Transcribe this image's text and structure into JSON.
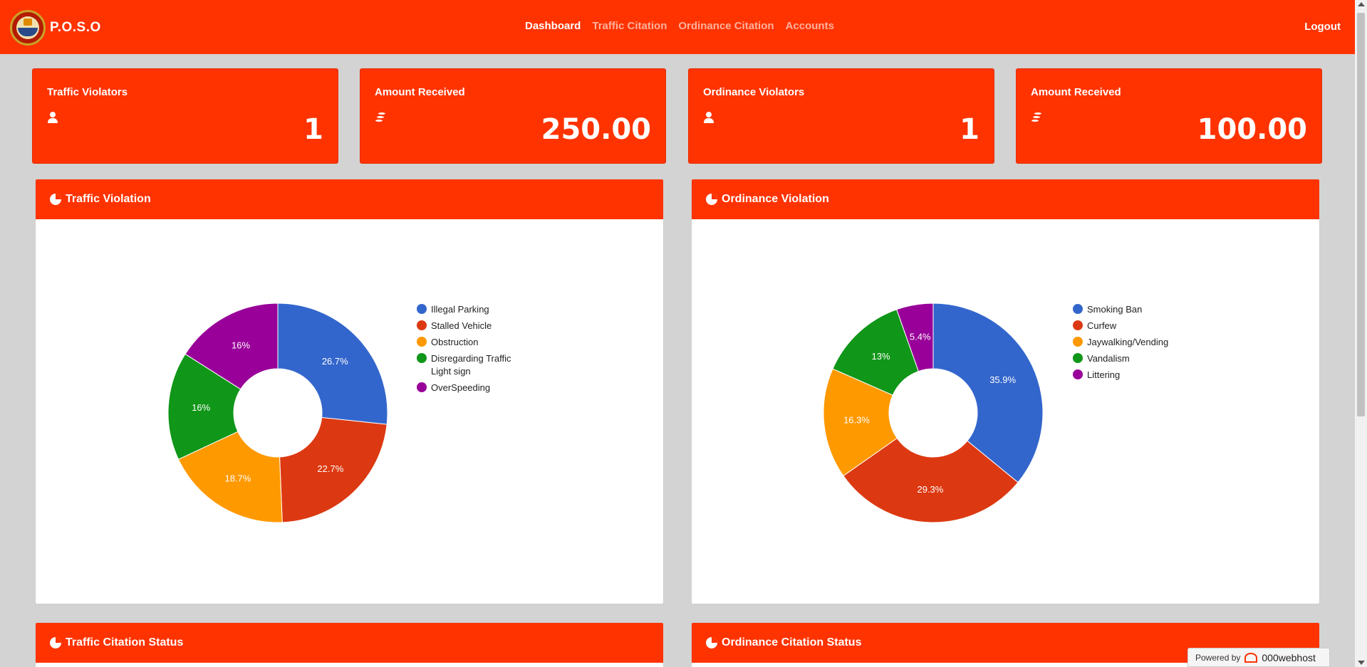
{
  "app": {
    "brand": "P.O.S.O"
  },
  "nav": {
    "items": [
      {
        "label": "Dashboard",
        "active": true
      },
      {
        "label": "Traffic Citation",
        "active": false
      },
      {
        "label": "Ordinance Citation",
        "active": false
      },
      {
        "label": "Accounts",
        "active": false
      }
    ],
    "logout": "Logout"
  },
  "stats": [
    {
      "title": "Traffic Violators",
      "icon": "user-icon",
      "value": "1"
    },
    {
      "title": "Amount Received",
      "icon": "coins-icon",
      "value": "250.00"
    },
    {
      "title": "Ordinance Violators",
      "icon": "user-icon",
      "value": "1"
    },
    {
      "title": "Amount Received",
      "icon": "coins-icon",
      "value": "100.00"
    }
  ],
  "panels": {
    "traffic": {
      "title": "Traffic Violation"
    },
    "ordinance": {
      "title": "Ordinance Violation"
    },
    "traffic_status": {
      "title": "Traffic Citation Status"
    },
    "ordinance_status": {
      "title": "Ordinance Citation Status"
    }
  },
  "colors": {
    "accent": "#ff3300",
    "background": "#d3d3d3",
    "series": [
      "#3366cc",
      "#dc3912",
      "#ff9900",
      "#109618",
      "#990099"
    ]
  },
  "chart_data": [
    {
      "type": "pie",
      "donut": true,
      "title": "Traffic Violation",
      "categories": [
        "Illegal Parking",
        "Stalled Vehicle",
        "Obstruction",
        "Disregarding Traffic Light sign",
        "OverSpeeding"
      ],
      "values": [
        26.7,
        22.7,
        18.7,
        16,
        16
      ],
      "labels": [
        "26.7%",
        "22.7%",
        "18.7%",
        "16%",
        "16%"
      ],
      "legend": "right"
    },
    {
      "type": "pie",
      "donut": true,
      "title": "Ordinance Violation",
      "categories": [
        "Smoking Ban",
        "Curfew",
        "Jaywalking/Vending",
        "Vandalism",
        "Littering"
      ],
      "values": [
        35.9,
        29.3,
        16.3,
        13,
        5.4
      ],
      "labels": [
        "35.9%",
        "29.3%",
        "16.3%",
        "13%",
        "5.4%"
      ],
      "legend": "right"
    }
  ],
  "footer": {
    "powered_by": "Powered by",
    "host": "000webhost"
  }
}
